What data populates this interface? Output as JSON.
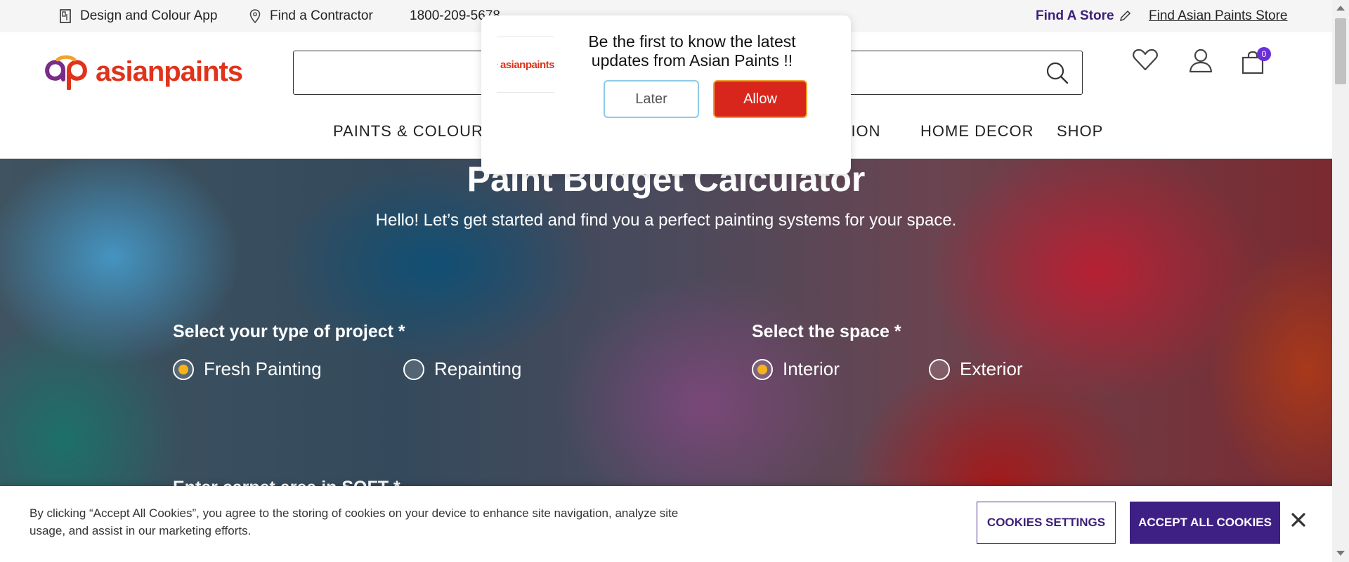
{
  "topbar": {
    "design_app": "Design and Colour App",
    "contractor": "Find a Contractor",
    "phone": "1800-209-5678",
    "find_store": "Find A Store",
    "find_asian_store": "Find Asian Paints Store"
  },
  "header": {
    "logo_text": "asianpaints",
    "search": {
      "value": "",
      "placeholder": ""
    },
    "cart_count": "0",
    "nav": [
      "PAINTS & COLOURS",
      "TION",
      "HOME DECOR",
      "SHOP"
    ]
  },
  "hero": {
    "title": "Paint Budget Calculator",
    "subtitle": "Hello! Let’s get started and find you a perfect painting systems for your space.",
    "project": {
      "label": "Select your type of project *",
      "options": [
        {
          "label": "Fresh Painting",
          "selected": true
        },
        {
          "label": "Repainting",
          "selected": false
        }
      ]
    },
    "space": {
      "label": "Select the space *",
      "options": [
        {
          "label": "Interior",
          "selected": true
        },
        {
          "label": "Exterior",
          "selected": false
        }
      ]
    },
    "area_label": "Enter carpet area in SQFT *"
  },
  "push_prompt": {
    "logo_text": "asianpaints",
    "message": "Be the first to know the latest updates from Asian Paints !!",
    "later": "Later",
    "allow": "Allow"
  },
  "cookie": {
    "text": "By clicking “Accept All Cookies”, you agree to the storing of cookies on your device to enhance site navigation, analyze site usage, and assist in our marketing efforts.",
    "settings": "COOKIES SETTINGS",
    "accept": "ACCEPT ALL COOKIES"
  },
  "colors": {
    "brand_red": "#e0331b",
    "brand_purple": "#3e1f83",
    "radio_selected": "#f6b21a",
    "allow_red": "#d9261c"
  }
}
